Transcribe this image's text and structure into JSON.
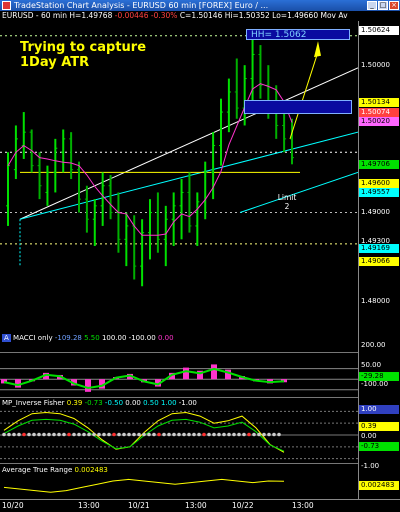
{
  "window": {
    "title": "TradeStation Chart Analysis - EURUSD 60 min [FOREX] Euro / ...",
    "buttons": [
      "_",
      "□",
      "×"
    ]
  },
  "infobar": {
    "symbol": "EURUSD - 60 min",
    "hl": "H=1.49768",
    "change": "-0.00446",
    "pct": "-0.30%",
    "last": "C=1.50146",
    "hi": "Hi=1.50352",
    "lo": "Lo=1.49660",
    "more": "Mov Av"
  },
  "annotation": {
    "line1": "Trying to capture",
    "line2": "1Day ATR",
    "hh_label": "HH= 1.5062",
    "limit_label": "Limit",
    "limit_num": "2"
  },
  "yaxis": {
    "main_ticks": [
      "1.50000",
      "1.49000",
      "1.48000"
    ],
    "main_boxes": [
      {
        "text": "1.50624",
        "color": "#ffffff"
      },
      {
        "text": "1.50134",
        "color": "#ffff00"
      },
      {
        "text": "1.50074",
        "color": "#ff4040"
      },
      {
        "text": "1.50020",
        "color": "#ff66ff"
      },
      {
        "text": "1.49706",
        "color": "#00e000"
      },
      {
        "text": "1.49600",
        "color": "#ffff00"
      },
      {
        "text": "1.49557",
        "color": "#00ffff"
      },
      {
        "text": "1.49300",
        "color": "#ffffff"
      },
      {
        "text": "1.49169",
        "color": "#00ffff"
      },
      {
        "text": "1.49066",
        "color": "#ffff00"
      }
    ],
    "macci_ticks": [
      "200.00",
      "50.00",
      "-100.00"
    ],
    "macci_box": {
      "text": "-29.28",
      "color": "#00e000"
    },
    "fisher_ticks": [
      "1.00",
      "0.39",
      "0.00",
      "-0.73",
      "-1.00"
    ],
    "atr_box": {
      "text": "0.002483",
      "color": "#ffff00"
    }
  },
  "xaxis": {
    "labels": [
      "10/20",
      "13:00",
      "10/21",
      "13:00",
      "10/22",
      "13:00"
    ]
  },
  "panels": {
    "macci": {
      "name": "MACCI only",
      "values": [
        "-109.28",
        "5.50",
        "100.00",
        "-100.00",
        "0.00"
      ]
    },
    "fisher": {
      "name": "MP_Inverse Fisher",
      "values": [
        "0.39",
        "-0.73",
        "-0.50",
        "0.00",
        "0.50",
        "1.00",
        "-1.00"
      ]
    },
    "atr": {
      "name": "Average True Range",
      "value": "0.002483"
    }
  },
  "colors": {
    "up_bar": "#00e000",
    "mov_av": "#ff33cc",
    "trend": "#ffffff",
    "channel": "#00ffff",
    "annotation": "#ffff00",
    "atr_line": "#ffff00"
  },
  "price_bars": [
    [
      1.492,
      1.4975,
      1.4935,
      1.4965
    ],
    [
      1.4955,
      1.4995,
      1.4962,
      1.4985
    ],
    [
      1.497,
      1.5005,
      1.498,
      1.499
    ],
    [
      1.496,
      1.4992,
      1.499,
      1.4965
    ],
    [
      1.494,
      1.4975,
      1.4965,
      1.495
    ],
    [
      1.4935,
      1.4965,
      1.4945,
      1.496
    ],
    [
      1.4945,
      1.4985,
      1.496,
      1.4978
    ],
    [
      1.496,
      1.4992,
      1.4975,
      1.4985
    ],
    [
      1.4955,
      1.499,
      1.4985,
      1.4962
    ],
    [
      1.493,
      1.4968,
      1.4962,
      1.494
    ],
    [
      1.4915,
      1.495,
      1.494,
      1.4925
    ],
    [
      1.4905,
      1.494,
      1.4925,
      1.4935
    ],
    [
      1.492,
      1.496,
      1.4935,
      1.495
    ],
    [
      1.4925,
      1.4958,
      1.495,
      1.493
    ],
    [
      1.49,
      1.4945,
      1.493,
      1.491
    ],
    [
      1.489,
      1.493,
      1.491,
      1.492
    ],
    [
      1.488,
      1.4928,
      1.492,
      1.489
    ],
    [
      1.4875,
      1.4925,
      1.489,
      1.4915
    ],
    [
      1.4895,
      1.494,
      1.4915,
      1.493
    ],
    [
      1.49,
      1.4945,
      1.493,
      1.491
    ],
    [
      1.489,
      1.4935,
      1.491,
      1.4925
    ],
    [
      1.4905,
      1.4945,
      1.4925,
      1.4935
    ],
    [
      1.491,
      1.4955,
      1.4935,
      1.4945
    ],
    [
      1.4915,
      1.496,
      1.4945,
      1.492
    ],
    [
      1.4905,
      1.4945,
      1.492,
      1.4938
    ],
    [
      1.4925,
      1.4968,
      1.4938,
      1.496
    ],
    [
      1.494,
      1.499,
      1.496,
      1.498
    ],
    [
      1.4965,
      1.5015,
      1.498,
      1.5005
    ],
    [
      1.499,
      1.503,
      1.5005,
      1.502
    ],
    [
      1.5,
      1.5045,
      1.502,
      1.5008
    ],
    [
      1.4995,
      1.504,
      1.5008,
      1.503
    ],
    [
      1.501,
      1.5062,
      1.503,
      1.5048
    ],
    [
      1.5015,
      1.5055,
      1.5048,
      1.5025
    ],
    [
      1.5,
      1.504,
      1.5025,
      1.501
    ],
    [
      1.4985,
      1.5025,
      1.501,
      1.4995
    ],
    [
      1.4975,
      1.501,
      1.4995,
      1.4985
    ],
    [
      1.4966,
      1.5,
      1.4985,
      1.4971
    ]
  ],
  "price_range": [
    1.4855,
    1.507
  ],
  "macci_values": [
    -40,
    -80,
    -20,
    60,
    40,
    -60,
    -120,
    -90,
    20,
    50,
    -30,
    -70,
    60,
    110,
    80,
    140,
    90,
    30,
    -20,
    -40,
    -29
  ],
  "macci_range": [
    -150,
    220
  ],
  "fisher_values": [
    0.2,
    0.6,
    0.9,
    0.95,
    0.9,
    0.7,
    0.3,
    -0.2,
    -0.6,
    -0.5,
    0.1,
    0.6,
    0.9,
    0.95,
    0.8,
    0.5,
    0.6,
    0.8,
    0.3,
    -0.4,
    -0.73
  ],
  "fisher_range": [
    -1.1,
    1.1
  ],
  "atr_values": [
    0.0021,
    0.002,
    0.0019,
    0.0018,
    0.0019,
    0.0021,
    0.0023,
    0.0025,
    0.0026,
    0.0025,
    0.0024,
    0.0023,
    0.0024,
    0.0025,
    0.0026,
    0.0025,
    0.0024,
    0.0025,
    0.00248
  ],
  "atr_range": [
    0.0015,
    0.003
  ]
}
